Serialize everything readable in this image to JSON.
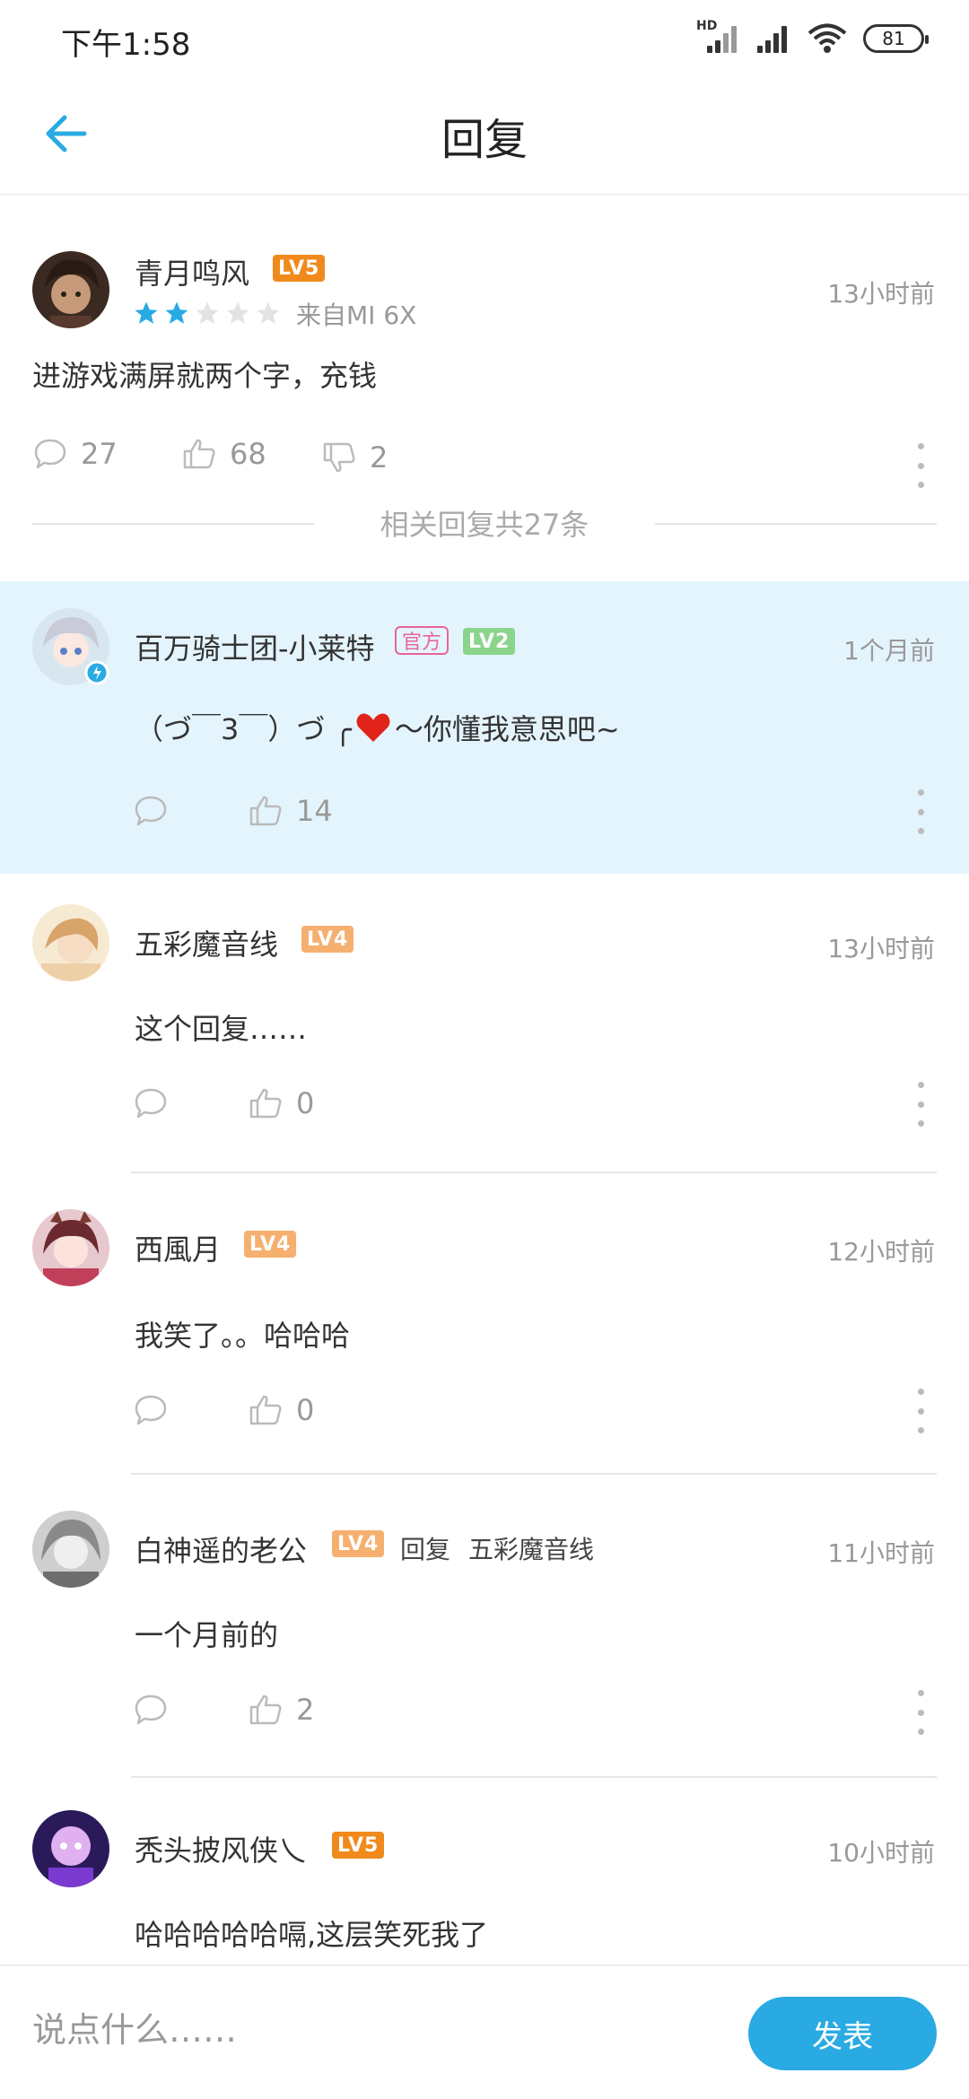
{
  "status_bar": {
    "time": "下午1:58",
    "battery": "81",
    "hd": "HD"
  },
  "header": {
    "title": "回复"
  },
  "main_comment": {
    "username": "青月鸣风",
    "level": "LV5",
    "rating": 2,
    "device": "来自MI 6X",
    "time": "13小时前",
    "content": "进游戏满屏就两个字，充钱",
    "comments": "27",
    "likes": "68",
    "dislikes": "2"
  },
  "related_label": "相关回复共27条",
  "replies": [
    {
      "username": "百万骑士团-小莱特",
      "official": "官方",
      "level": "LV2",
      "time": "1个月前",
      "content": "（づ￣3￣）づ ╭",
      "content_tail": "～你懂我意思吧~",
      "likes": "14"
    },
    {
      "username": "五彩魔音线",
      "level": "LV4",
      "time": "13小时前",
      "content": "这个回复……",
      "likes": "0"
    },
    {
      "username": "西風月",
      "level": "LV4",
      "time": "12小时前",
      "content": "我笑了。。哈哈哈",
      "likes": "0"
    },
    {
      "username": "白神遥的老公",
      "level": "LV4",
      "reply_word": "回复",
      "reply_target": "五彩魔音线",
      "time": "11小时前",
      "content": "一个月前的",
      "likes": "2"
    },
    {
      "username": "秃头披风侠乀",
      "level": "LV5",
      "time": "10小时前",
      "content": "哈哈哈哈哈嗝,这层笑死我了"
    }
  ],
  "bottom_bar": {
    "placeholder": "说点什么……",
    "send_label": "发表"
  },
  "colors": {
    "accent": "#29aae3",
    "highlight": "#e4f4fd",
    "lv5": "#f08a1c",
    "lv4": "#f5b070",
    "lv2": "#8bd48c",
    "official": "#e8649a",
    "star": "#29aae3"
  }
}
